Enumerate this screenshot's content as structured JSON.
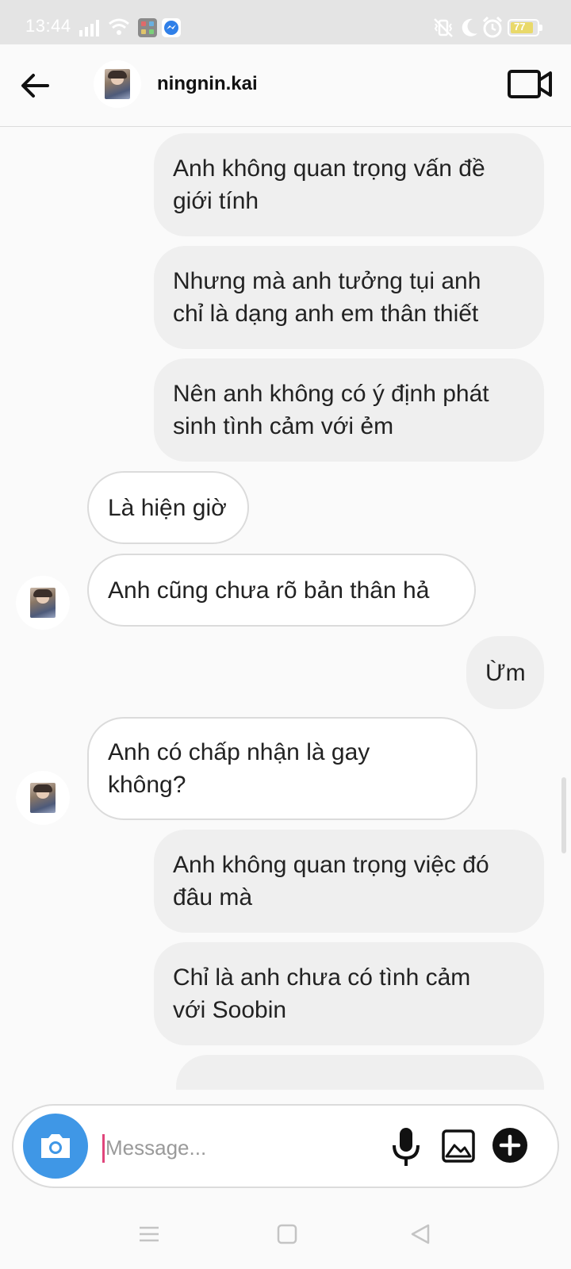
{
  "status_bar": {
    "time": "13:44",
    "battery": "77",
    "icons": [
      "signal-icon",
      "wifi-icon",
      "app-notification-icon",
      "messenger-icon",
      "vibrate-icon",
      "moon-icon",
      "alarm-icon",
      "battery-icon"
    ]
  },
  "header": {
    "back_icon": "back-arrow-icon",
    "username": "ningnin.kai",
    "video_icon": "video-call-icon"
  },
  "messages": [
    {
      "direction": "outgoing",
      "lines": [
        "Anh không quan trọng vấn đề",
        "giới tính"
      ]
    },
    {
      "direction": "outgoing",
      "lines": [
        "Nhưng mà anh tưởng tụi anh",
        "chỉ là dạng anh em thân thiết"
      ]
    },
    {
      "direction": "outgoing",
      "lines": [
        "Nên anh không có ý định phát",
        "sinh tình cảm với ẻm"
      ]
    },
    {
      "direction": "incoming",
      "lines": [
        "Là hiện giờ"
      ]
    },
    {
      "direction": "incoming",
      "lines": [
        "Anh cũng chưa rõ bản thân hả"
      ]
    },
    {
      "direction": "outgoing",
      "lines": [
        "Ừm"
      ]
    },
    {
      "direction": "incoming",
      "lines": [
        "Anh có chấp nhận là gay",
        "không?"
      ]
    },
    {
      "direction": "outgoing",
      "lines": [
        "Anh không quan trọng việc đó",
        "đâu mà"
      ]
    },
    {
      "direction": "outgoing",
      "lines": [
        "Chỉ là anh chưa có tình cảm",
        "với Soobin"
      ]
    }
  ],
  "composer": {
    "placeholder": "Message...",
    "value": "",
    "icons": [
      "camera-icon",
      "microphone-icon",
      "gallery-icon",
      "plus-icon"
    ]
  },
  "nav_bar": {
    "icons": [
      "menu-icon",
      "home-icon",
      "back-icon"
    ]
  },
  "colors": {
    "outgoing_bubble": "#efefef",
    "incoming_bubble": "#ffffff",
    "accent_camera": "#3f97e6",
    "caret": "#e0457b"
  }
}
